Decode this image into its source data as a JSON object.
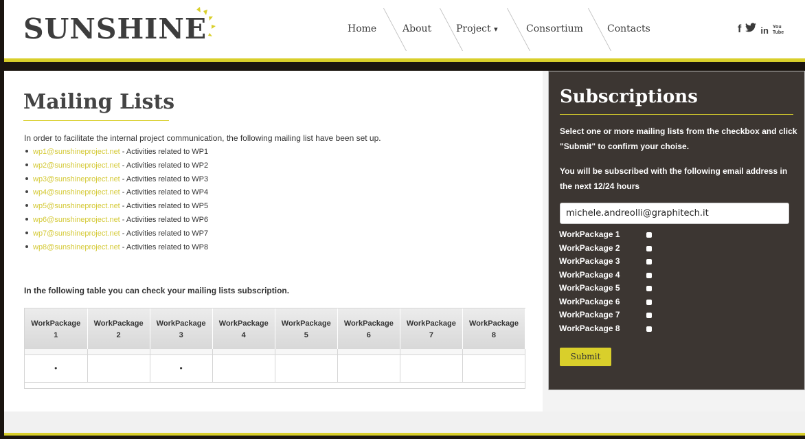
{
  "header": {
    "logo_text": "SUNSHINE",
    "nav": [
      {
        "label": "Home"
      },
      {
        "label": "About"
      },
      {
        "label": "Project"
      },
      {
        "label": "Consortium"
      },
      {
        "label": "Contacts"
      }
    ],
    "project_caret": "▾",
    "social": {
      "facebook": "f",
      "twitter": "🐦",
      "linkedin": "in",
      "youtube_top": "You",
      "youtube_bottom": "Tube"
    }
  },
  "main": {
    "title": "Mailing Lists",
    "intro": "In order to facilitate the internal project communication, the following mailing list have been set up.",
    "mailing_lists": [
      {
        "email": "wp1@sunshineproject.net",
        "desc": " - Activities related to WP1"
      },
      {
        "email": "wp2@sunshineproject.net",
        "desc": " - Activities related to WP2"
      },
      {
        "email": "wp3@sunshineproject.net",
        "desc": " - Activities related to WP3"
      },
      {
        "email": "wp4@sunshineproject.net",
        "desc": " - Activities related to WP4"
      },
      {
        "email": "wp5@sunshineproject.net",
        "desc": " - Activities related to WP5"
      },
      {
        "email": "wp6@sunshineproject.net",
        "desc": " - Activities related to WP6"
      },
      {
        "email": "wp7@sunshineproject.net",
        "desc": " - Activities related to WP7"
      },
      {
        "email": "wp8@sunshineproject.net",
        "desc": " - Activities related to WP8"
      }
    ],
    "table_caption": "In the following table you can check your mailing lists subscription.",
    "table": {
      "headers": [
        {
          "name": "WorkPackage",
          "num": "1"
        },
        {
          "name": "WorkPackage",
          "num": "2"
        },
        {
          "name": "WorkPackage",
          "num": "3"
        },
        {
          "name": "WorkPackage",
          "num": "4"
        },
        {
          "name": "WorkPackage",
          "num": "5"
        },
        {
          "name": "WorkPackage",
          "num": "6"
        },
        {
          "name": "WorkPackage",
          "num": "7"
        },
        {
          "name": "WorkPackage",
          "num": "8"
        }
      ],
      "row": [
        "•",
        "",
        "•",
        "",
        "",
        "",
        "",
        ""
      ]
    }
  },
  "sidebar": {
    "title": "Subscriptions",
    "instructions": "Select one or more mailing lists from the checkbox and click \"Submit\" to confirm your choise.",
    "email_note": "You will be subscribed with the following email address in the next 12/24 hours",
    "email_value": "michele.andreolli@graphitech.it",
    "workpackages": [
      "WorkPackage 1",
      "WorkPackage 2",
      "WorkPackage 3",
      "WorkPackage 4",
      "WorkPackage 5",
      "WorkPackage 6",
      "WorkPackage 7",
      "WorkPackage 8"
    ],
    "submit_label": "Submit"
  },
  "colors": {
    "accent_yellow": "#d9cf2b",
    "link_yellow": "#d4c935",
    "sidebar_bg": "#3c3632",
    "dark_band": "#1b1510"
  }
}
